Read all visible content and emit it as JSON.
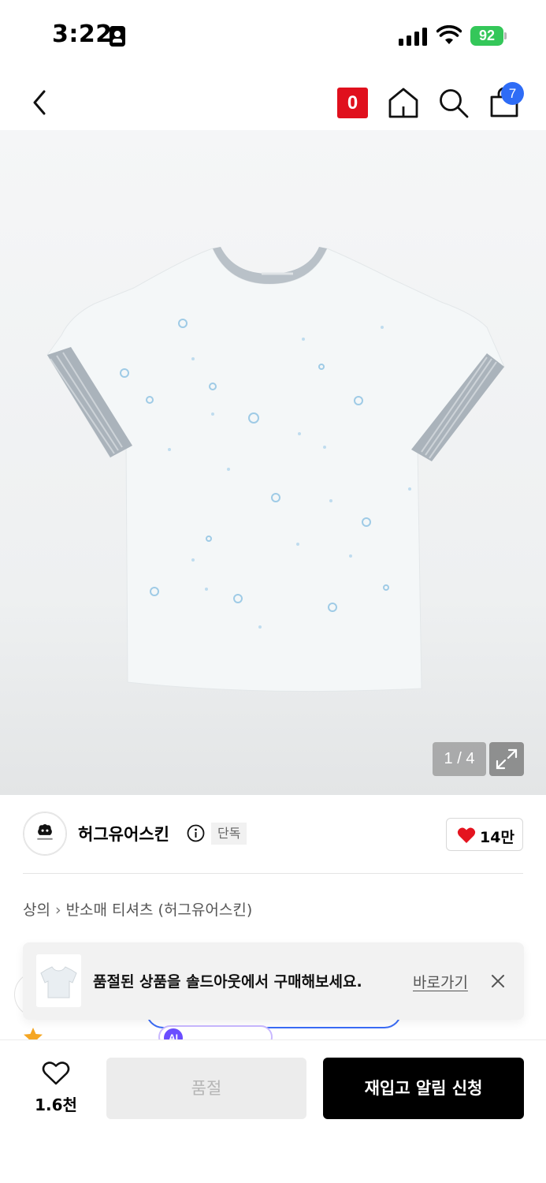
{
  "status_bar": {
    "time": "3:22",
    "battery": "92"
  },
  "header": {
    "badge_label": "0",
    "cart_count": "7",
    "icons": [
      "back-icon",
      "home-icon",
      "search-icon",
      "shopping-bag-icon"
    ]
  },
  "gallery": {
    "counter": "1 / 4",
    "expand_icon": "expand-icon"
  },
  "brand": {
    "name": "허그유어스킨",
    "exclusive_badge": "단독",
    "like_count": "14만"
  },
  "breadcrumb": {
    "category": "상의",
    "subcategory": "반소매 티셔츠 (허그유어스킨)"
  },
  "rating": {
    "ai_badge_letter": "AI"
  },
  "toast": {
    "message": "품절된 상품을 솔드아웃에서 구매해보세요.",
    "link_label": "바로가기"
  },
  "bottom_bar": {
    "wish_count": "1.6천",
    "soldout_label": "품절",
    "restock_label": "재입고 알림 신청"
  },
  "colors": {
    "accent_red": "#e0101d",
    "cart_badge_blue": "#2e6cf6",
    "battery_green": "#34c759",
    "primary_button": "#000000",
    "ai_purple": "#6a4dff"
  }
}
